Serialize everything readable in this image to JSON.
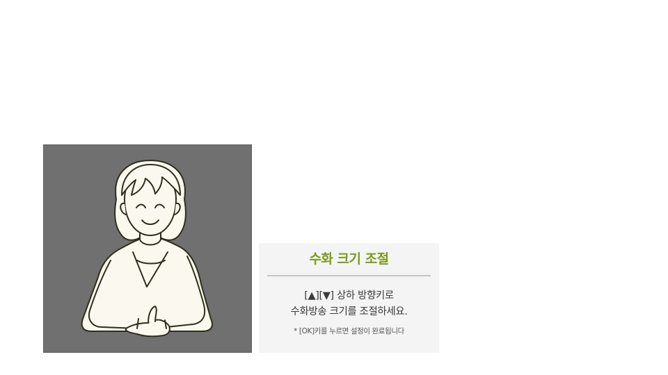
{
  "signer_window": {
    "illustration": "smiling-woman-sign-language-interpreter",
    "background_color": "#707070"
  },
  "panel": {
    "title": "수화 크기 조절",
    "line1": "[▲][▼] 상하 방향키로",
    "line2": "수화방송 크기를 조절하세요.",
    "note": "* [OK]키를 누르면 설정이 완료됩니다",
    "title_color": "#7b9a1c",
    "background_color": "#f4f4f4"
  }
}
